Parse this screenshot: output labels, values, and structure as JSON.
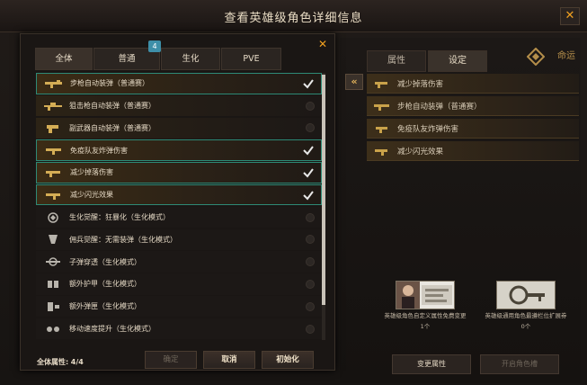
{
  "window": {
    "title": "查看英雄级角色详细信息",
    "close_label": "✕"
  },
  "dialog": {
    "close_label": "✕",
    "tabs": [
      {
        "label": "全体",
        "active": true
      },
      {
        "label": "普通",
        "badge": "4"
      },
      {
        "label": "生化"
      },
      {
        "label": "PVE"
      }
    ],
    "items": [
      {
        "label": "步枪自动装弹（普通赛）",
        "checked": true,
        "icon": "rifle-icon"
      },
      {
        "label": "狙击枪自动装弹（普通赛）",
        "checked": false,
        "icon": "sniper-icon"
      },
      {
        "label": "副武器自动装弹（普通赛）",
        "checked": false,
        "icon": "pistol-icon"
      },
      {
        "label": "免疫队友炸弹伤害",
        "checked": true,
        "icon": "grenade-icon"
      },
      {
        "label": "减少掉落伤害",
        "checked": true,
        "icon": "fall-damage-icon"
      },
      {
        "label": "减少闪光效果",
        "checked": true,
        "icon": "flash-icon"
      },
      {
        "label": "生化觉醒：狂暴化（生化模式）",
        "checked": false,
        "icon": "berserk-icon"
      },
      {
        "label": "佣兵觉醒：无需装弹（生化模式）",
        "checked": false,
        "icon": "mercenary-icon"
      },
      {
        "label": "子弹穿透（生化模式）",
        "checked": false,
        "icon": "penetration-icon"
      },
      {
        "label": "额外护甲（生化模式）",
        "checked": false,
        "icon": "armor-icon"
      },
      {
        "label": "额外弹匣（生化模式）",
        "checked": false,
        "icon": "magazine-icon"
      },
      {
        "label": "移动速度提升（生化模式）",
        "checked": false,
        "icon": "speed-icon"
      }
    ],
    "total_label": "全体属性:",
    "total_value": "4/4",
    "buttons": {
      "confirm": "确定",
      "cancel": "取消",
      "reset": "初始化"
    }
  },
  "right_panel": {
    "tabs": [
      {
        "label": "属性"
      },
      {
        "label": "设定",
        "active": true
      }
    ],
    "brand": "命运",
    "collapse_label": "«",
    "settings": [
      "减少掉落伤害",
      "步枪自动装弹（普通赛）",
      "免疫队友炸弹伤害",
      "减少闪光效果"
    ],
    "cards": [
      {
        "caption": "英雄级角色自定义属性免费变更",
        "count": "1个"
      },
      {
        "caption": "英雄级通用角色最遵栏位扩展券",
        "count": "0个"
      }
    ],
    "buttons": {
      "change": "变更属性",
      "open": "开启角色槽"
    }
  },
  "colors": {
    "accent": "#f0a020",
    "checked_border": "#2e8a76",
    "badge": "#3e8fa8"
  }
}
